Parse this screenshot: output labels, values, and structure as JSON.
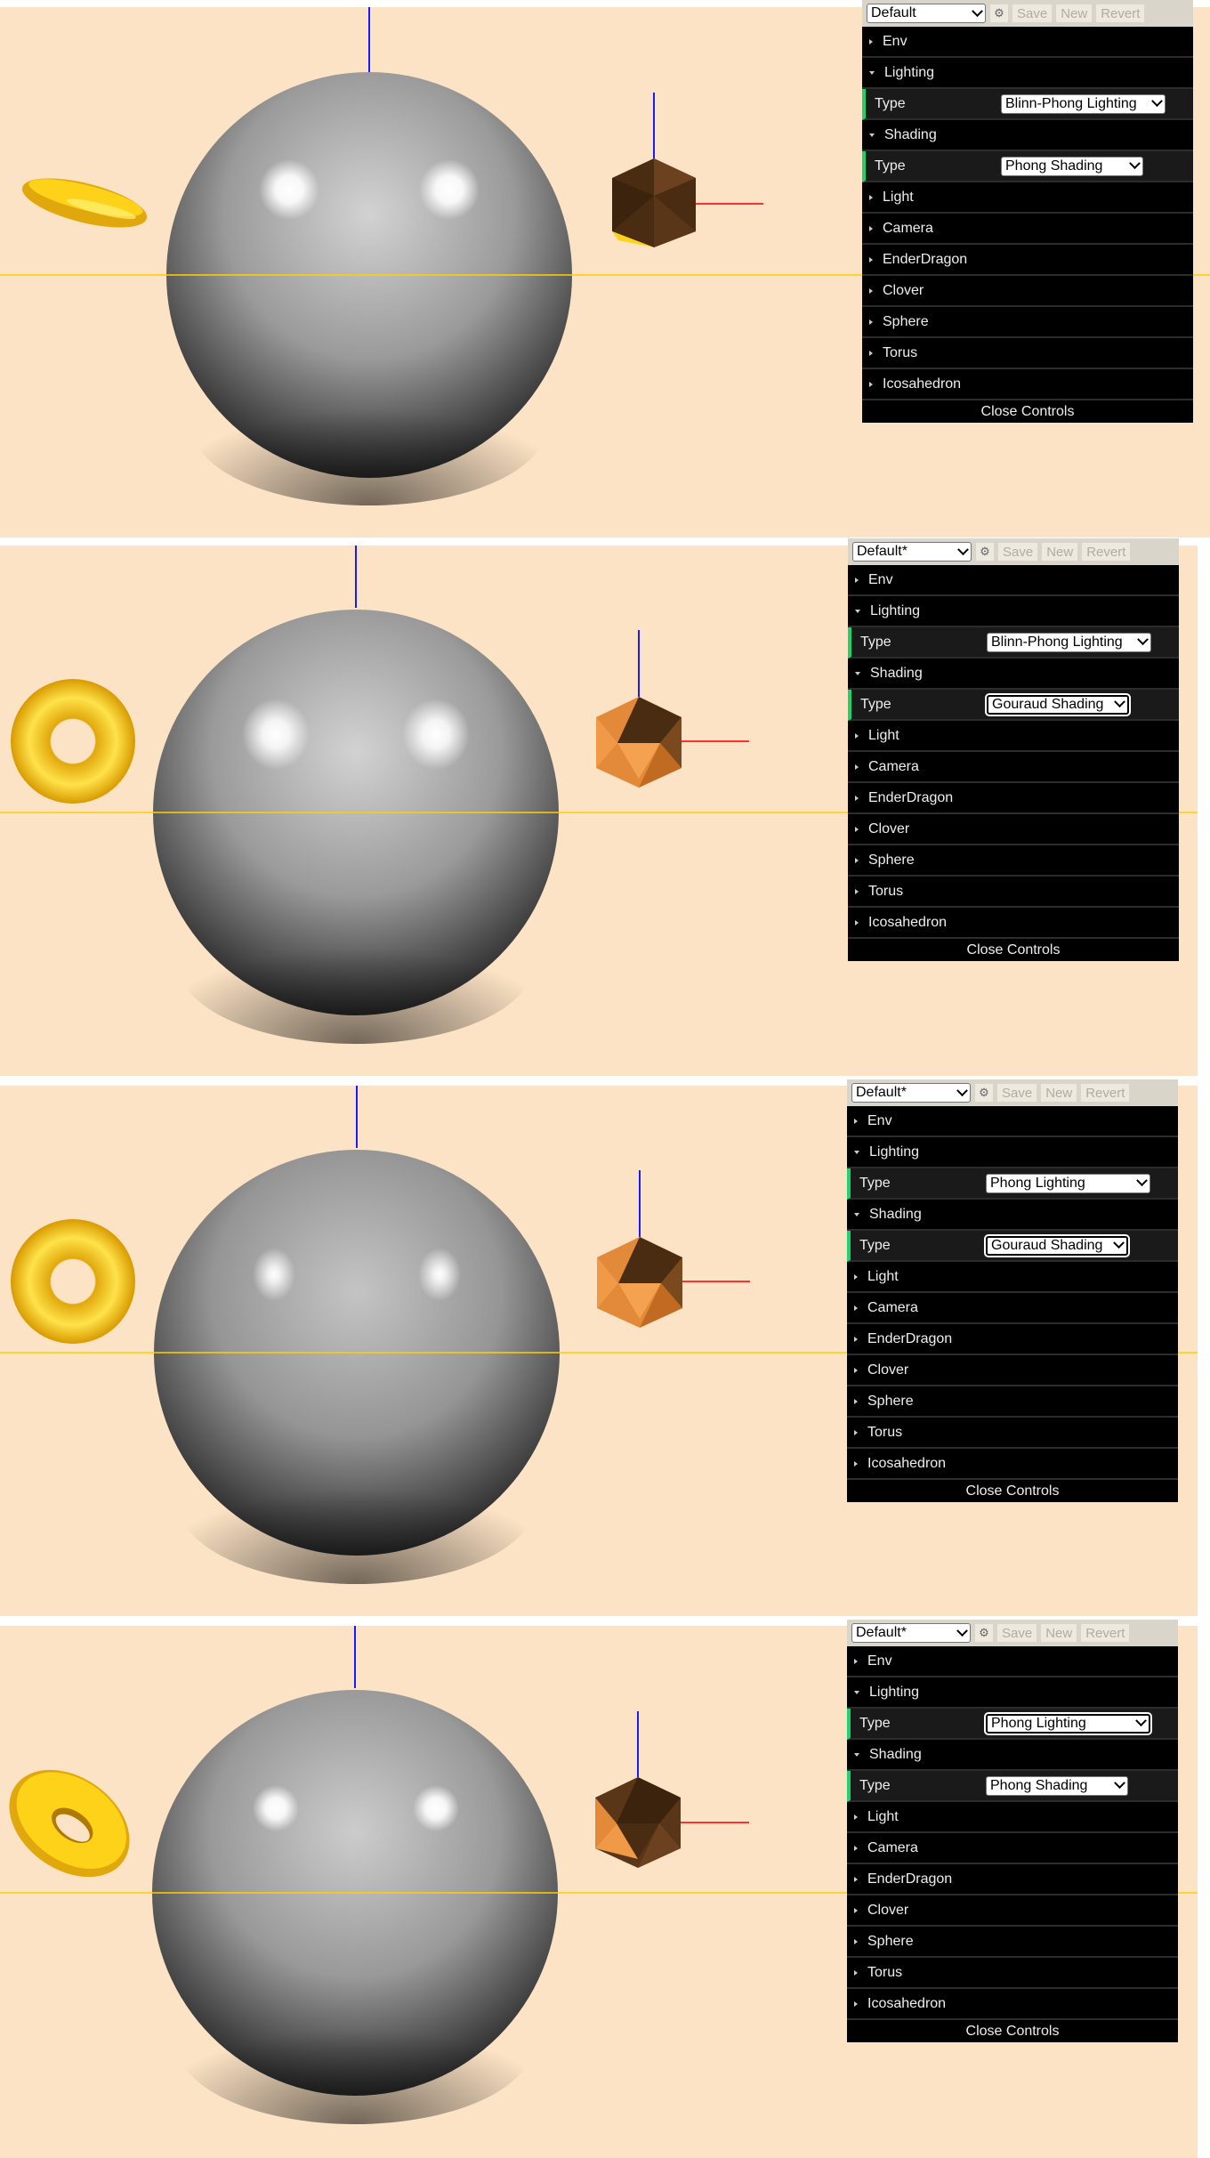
{
  "colors": {
    "scene_bg": "#fde3c5",
    "axis_y": "#1a1aff",
    "axis_x": "#ff3030",
    "ground_line": "#ffd000",
    "sphere": "#9a9a9a",
    "torus": "#ffd21a",
    "icosahedron": "#e38a3a"
  },
  "panels": [
    {
      "preset": "Default",
      "save": "Save",
      "new": "New",
      "revert": "Revert",
      "folders_top": [
        "Env"
      ],
      "lighting_label": "Lighting",
      "lighting_type_label": "Type",
      "lighting_type": "Blinn-Phong Lighting",
      "shading_label": "Shading",
      "shading_type_label": "Type",
      "shading_type": "Phong Shading",
      "folders_bottom": [
        "Light",
        "Camera",
        "EnderDragon",
        "Clover",
        "Sphere",
        "Torus",
        "Icosahedron"
      ],
      "close": "Close Controls"
    },
    {
      "preset": "Default*",
      "save": "Save",
      "new": "New",
      "revert": "Revert",
      "folders_top": [
        "Env"
      ],
      "lighting_label": "Lighting",
      "lighting_type_label": "Type",
      "lighting_type": "Blinn-Phong Lighting",
      "shading_label": "Shading",
      "shading_type_label": "Type",
      "shading_type": "Gouraud Shading",
      "folders_bottom": [
        "Light",
        "Camera",
        "EnderDragon",
        "Clover",
        "Sphere",
        "Torus",
        "Icosahedron"
      ],
      "close": "Close Controls"
    },
    {
      "preset": "Default*",
      "save": "Save",
      "new": "New",
      "revert": "Revert",
      "folders_top": [
        "Env"
      ],
      "lighting_label": "Lighting",
      "lighting_type_label": "Type",
      "lighting_type": "Phong Lighting",
      "shading_label": "Shading",
      "shading_type_label": "Type",
      "shading_type": "Gouraud Shading",
      "folders_bottom": [
        "Light",
        "Camera",
        "EnderDragon",
        "Clover",
        "Sphere",
        "Torus",
        "Icosahedron"
      ],
      "close": "Close Controls"
    },
    {
      "preset": "Default*",
      "save": "Save",
      "new": "New",
      "revert": "Revert",
      "folders_top": [
        "Env"
      ],
      "lighting_label": "Lighting",
      "lighting_type_label": "Type",
      "lighting_type": "Phong Lighting",
      "shading_label": "Shading",
      "shading_type_label": "Type",
      "shading_type": "Phong Shading",
      "folders_bottom": [
        "Light",
        "Camera",
        "EnderDragon",
        "Clover",
        "Sphere",
        "Torus",
        "Icosahedron"
      ],
      "close": "Close Controls"
    }
  ]
}
